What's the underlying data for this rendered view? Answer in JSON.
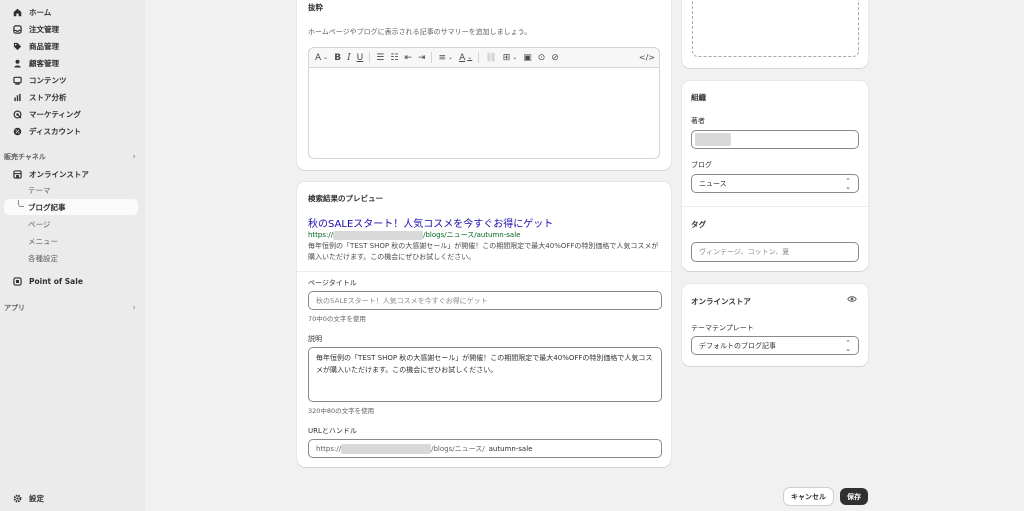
{
  "nav": {
    "home": "ホーム",
    "orders": "注文管理",
    "products": "商品管理",
    "customers": "顧客管理",
    "content": "コンテンツ",
    "analytics": "ストア分析",
    "marketing": "マーケティング",
    "discounts": "ディスカウント",
    "sales_channels": "販売チャネル",
    "online_store": "オンラインストア",
    "theme": "テーマ",
    "blog_posts": "ブログ記事",
    "pages": "ページ",
    "menu": "メニュー",
    "preferences": "各種設定",
    "pos": "Point of Sale",
    "apps": "アプリ",
    "settings": "設定"
  },
  "excerpt": {
    "title": "抜粋",
    "description": "ホームページやブログに表示される記事のサマリーを追加しましょう。"
  },
  "seo": {
    "title": "検索結果のプレビュー",
    "preview_title": "秋のSALEスタート！人気コスメを今すぐお得にゲット",
    "preview_url_prefix": "https://",
    "preview_url_suffix": "/blogs/ニュース/autumn-sale",
    "preview_description": "毎年恒例の「TEST SHOP 秋の大感謝セール」が開催！この期間限定で最大40%OFFの特別価格で人気コスメが購入いただけます。この機会にぜひお試しください。",
    "page_title_label": "ページタイトル",
    "page_title_placeholder": "秋のSALEスタート！人気コスメを今すぐお得にゲット",
    "page_title_count": "70中0の文字を使用",
    "description_label": "説明",
    "description_value": "毎年恒例の「TEST SHOP 秋の大感謝セール」が開催！この期間限定で最大40%OFFの特別価格で人気コスメが購入いただけます。この機会にぜひお試しください。",
    "description_count": "320中80の文字を使用",
    "url_label": "URLとハンドル",
    "url_prefix": "https://",
    "url_path": "/blogs/ニュース/",
    "url_handle": "autumn-sale"
  },
  "organization": {
    "title": "組織",
    "author_label": "著者",
    "blog_label": "ブログ",
    "blog_value": "ニュース",
    "tags_label": "タグ",
    "tags_placeholder": "ヴィンテージ、コットン、夏"
  },
  "online_store_card": {
    "title": "オンラインストア",
    "template_label": "テーマテンプレート",
    "template_value": "デフォルトのブログ記事"
  },
  "actions": {
    "cancel": "キャンセル",
    "save": "保存"
  },
  "colors": {
    "link_title": "#1a0dab",
    "link_url": "#006621",
    "primary_button": "#303030"
  }
}
